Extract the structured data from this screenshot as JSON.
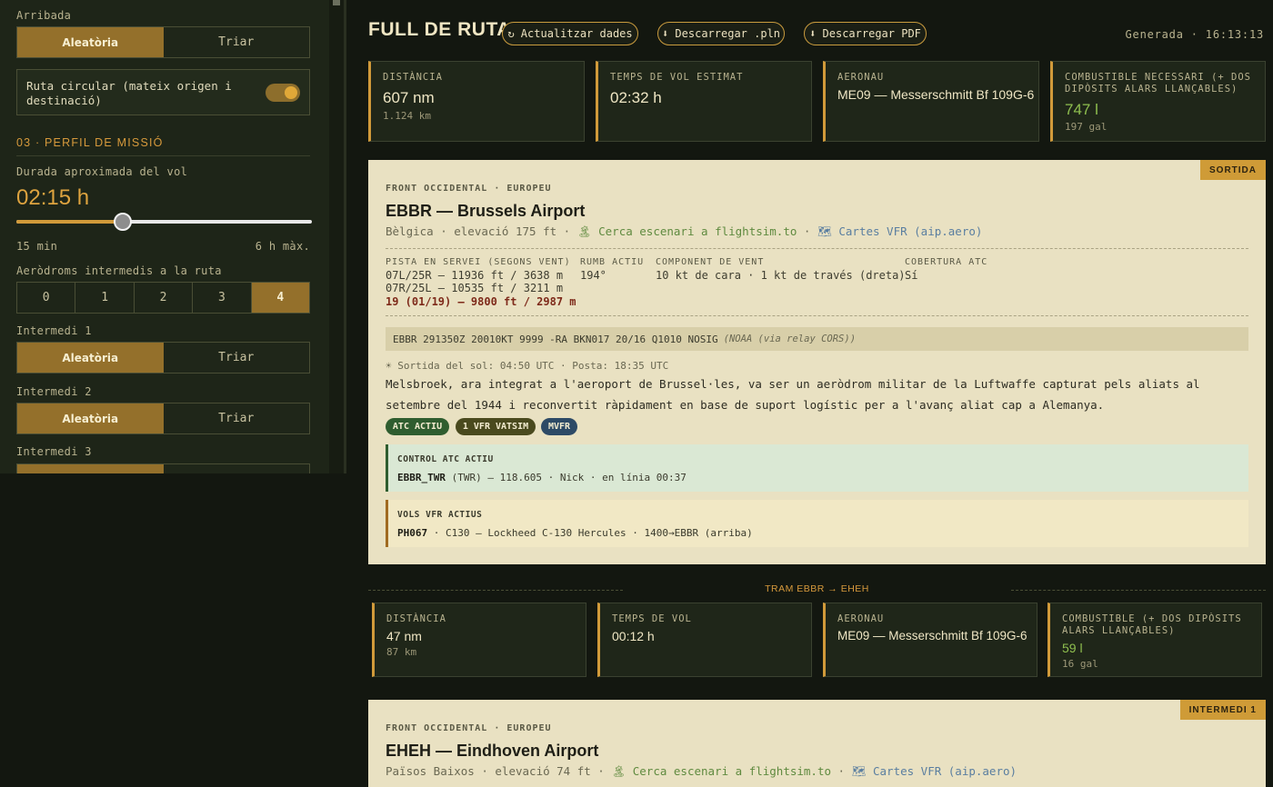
{
  "sidebar": {
    "arrival_label": "Arribada",
    "arrival_mode": {
      "random": "Aleatòria",
      "choose": "Triar"
    },
    "circular_label": "Ruta circular (mateix origen i destinació)",
    "section_title": "03 · PERFIL DE MISSIÓ",
    "duration_label": "Durada aproximada del vol",
    "duration_value": "02:15 h",
    "duration_fraction": 0.36,
    "duration_min": "15 min",
    "duration_max": "6 h màx.",
    "intermediate_label": "Aeròdroms intermedis a la ruta",
    "intermediate_options": [
      "0",
      "1",
      "2",
      "3",
      "4"
    ],
    "intermediate_selected": "4",
    "intermediates": [
      {
        "label": "Intermedi 1",
        "random": "Aleatòria",
        "choose": "Triar"
      },
      {
        "label": "Intermedi 2",
        "random": "Aleatòria",
        "choose": "Triar"
      },
      {
        "label": "Intermedi 3"
      }
    ]
  },
  "header": {
    "title": "FULL DE RUTA",
    "refresh_button": "↻ Actualitzar dades",
    "pln_button": "⬇ Descarregar .pln",
    "pdf_button": "⬇ Descarregar PDF",
    "generated": "Generada · 16:13:13"
  },
  "summary": [
    {
      "label": "DISTÀNCIA",
      "value": "607 nm",
      "sub": "1.124 km"
    },
    {
      "label": "TEMPS DE VOL ESTIMAT",
      "value": "02:32 h",
      "sub": ""
    },
    {
      "label": "AERONAU",
      "value": "ME09 — Messerschmitt Bf 109G-6",
      "sub": ""
    },
    {
      "label": "COMBUSTIBLE NECESSARI (+ DOS DIPÒSITS ALARS LLANÇABLES)",
      "value": "747 l",
      "sub": "197 gal"
    }
  ],
  "departure": {
    "badge": "SORTIDA",
    "kicker": "FRONT OCCIDENTAL · EUROPEU",
    "title": "EBBR — Brussels Airport",
    "country": "Bèlgica · elevació 175 ft ·",
    "scenery_link": "🏝 Cerca escenari a flightsim.to",
    "sep": "·",
    "vfr_link": "🗺 Cartes VFR (aip.aero)",
    "runways_h": "PISTA EN SERVEI (SEGONS VENT)",
    "runways": [
      "07L/25R — 11936 ft / 3638 m",
      "07R/25L — 10535 ft / 3211 m"
    ],
    "runway_active": "19 (01/19) — 9800 ft / 2987 m",
    "heading_h": "RUMB ACTIU",
    "heading": "194°",
    "wind_h": "COMPONENT DE VENT",
    "wind": "10 kt de cara · 1 kt de través (dreta)",
    "atc_h": "COBERTURA ATC",
    "atc": "Sí",
    "metar": "EBBR 291350Z 20010KT 9999 -RA BKN017 20/16 Q1010 NOSIG",
    "metar_src": "(NOAA (via relay CORS))",
    "sun": "☀ Sortida del sol: 04:50 UTC · Posta: 18:35 UTC",
    "description": "Melsbroek, ara integrat a l'aeroport de Brussel·les, va ser un aeròdrom militar de la Luftwaffe capturat pels aliats al setembre del 1944 i reconvertit ràpidament en base de suport logístic per a l'avanç aliat cap a Alemanya.",
    "tags": [
      "ATC ACTIU",
      "1 VFR VATSIM",
      "MVFR"
    ],
    "atc_box_title": "CONTROL ATC ACTIU",
    "atc_box_call": "EBBR_TWR",
    "atc_box_text": "(TWR) — 118.605 · Nick · en línia 00:37",
    "vfr_box_title": "VOLS VFR ACTIUS",
    "vfr_box_call": "PH067",
    "vfr_box_text": "· C130 — Lockheed C-130 Hercules · 1400→EBBR (arriba)"
  },
  "leg": {
    "title": "TRAM EBBR → EHEH",
    "stats": [
      {
        "label": "DISTÀNCIA",
        "value": "47 nm",
        "sub": "87 km"
      },
      {
        "label": "TEMPS DE VOL",
        "value": "00:12 h",
        "sub": ""
      },
      {
        "label": "AERONAU",
        "value": "ME09 — Messerschmitt Bf 109G-6",
        "sub": ""
      },
      {
        "label": "COMBUSTIBLE (+ DOS DIPÒSITS ALARS LLANÇABLES)",
        "value": "59 l",
        "sub": "16 gal"
      }
    ]
  },
  "intermediate1": {
    "badge": "INTERMEDI 1",
    "kicker": "FRONT OCCIDENTAL · EUROPEU",
    "title": "EHEH — Eindhoven Airport",
    "country": "Països Baixos · elevació 74 ft ·",
    "scenery_link": "🏝 Cerca escenari a flightsim.to",
    "sep": "·",
    "vfr_link": "🗺 Cartes VFR (aip.aero)"
  },
  "colors": {
    "accent": "#d19a3a",
    "fuel": "#8fbf4f",
    "atc_tag": "#2f5d2f",
    "vfr_tag": "#4a4a1e",
    "mvfr_tag": "#2d4a66"
  }
}
